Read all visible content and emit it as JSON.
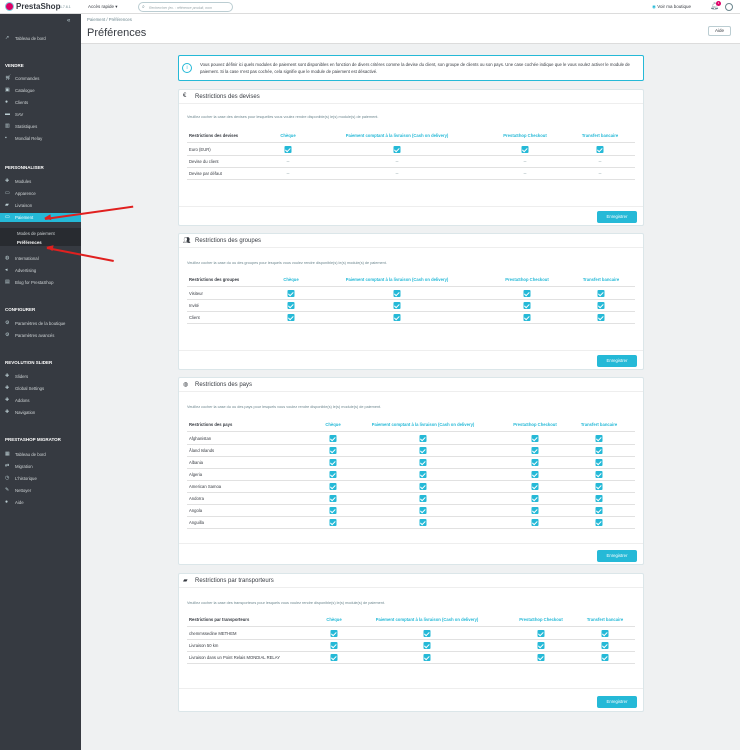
{
  "topbar": {
    "brand": "PrestaShop",
    "version": "1.7.6.1",
    "quick_access": "Accès rapide ▾",
    "search_placeholder": "Rechercher (ex. : référence produit, nom",
    "view_shop": "Voir ma boutique",
    "notif_count": "1"
  },
  "sidebar": {
    "dashboard": "Tableau de bord",
    "sections": [
      {
        "title": "VENDRE",
        "items": [
          "Commandes",
          "Catalogue",
          "Clients",
          "SAV",
          "Statistiques",
          "Mondial Relay"
        ]
      },
      {
        "title": "PERSONNALISER",
        "items": [
          "Modules",
          "Apparence",
          "Livraison",
          "Paiement",
          "International",
          "Advertising",
          "Blog for PrestaShop"
        ],
        "subitems": [
          "Modes de paiement",
          "Préférences"
        ]
      },
      {
        "title": "CONFIGURER",
        "items": [
          "Paramètres de la boutique",
          "Paramètres avancés"
        ]
      },
      {
        "title": "REVOLUTION SLIDER",
        "items": [
          "Sliders",
          "Global Settings",
          "Addons",
          "Navigation"
        ]
      },
      {
        "title": "PRESTASHOP MIGRATOR",
        "items": [
          "Tableau de bord",
          "Migration",
          "L'historique",
          "Nettoyer",
          "Aide"
        ]
      }
    ]
  },
  "header": {
    "breadcrumb": "Paiement  /  Préférences",
    "title": "Préférences",
    "help": "Aide"
  },
  "info": "Vous pouvez définir ici quels modules de paiement sont disponibles en fonction de divers critères comme la devise du client, son groupe de clients ou son pays. Une case cochée indique que le vous voulez activer le module de paiement. Si la case n'est pas cochée, cela signifie que le module de paiement est désactivé.",
  "columns": [
    "Chèque",
    "Paiement comptant à la livraison (Cash on delivery)",
    "PrestaShop Checkout",
    "Transfert bancaire"
  ],
  "save_label": "Enregistrer",
  "panels": {
    "currency": {
      "title": "Restrictions des devises",
      "desc": "Veuillez cocher la case des devises pour lesquelles vous voulez rendre disponible(s) le(s) module(s) de paiement.",
      "col0": "Restrictions des devises",
      "rows": [
        {
          "label": "Euro (EUR)",
          "cells": [
            "check",
            "check",
            "check",
            "check"
          ]
        },
        {
          "label": "Devise du client",
          "cells": [
            "--",
            "--",
            "--",
            "--"
          ]
        },
        {
          "label": "Devise par défaut",
          "cells": [
            "--",
            "--",
            "--",
            "--"
          ]
        }
      ]
    },
    "groups": {
      "title": "Restrictions des groupes",
      "desc": "Veuillez cocher la case du ou des groupes pour lesquels vous voulez rendre disponible(s) le(s) module(s) de paiement.",
      "col0": "Restrictions des groupes",
      "rows": [
        {
          "label": "Visiteur"
        },
        {
          "label": "Invité"
        },
        {
          "label": "Client"
        }
      ]
    },
    "countries": {
      "title": "Restrictions des pays",
      "desc": "Veuillez cocher la case du ou des pays pour lesquels vous voulez rendre disponible(s) le(s) module(s) de paiement.",
      "col0": "Restrictions des pays",
      "rows": [
        {
          "label": "Afghanistan"
        },
        {
          "label": "Åland Islands"
        },
        {
          "label": "Albania"
        },
        {
          "label": "Algeria"
        },
        {
          "label": "American Samoa"
        },
        {
          "label": "Andorra"
        },
        {
          "label": "Angola"
        },
        {
          "label": "Anguilla"
        }
      ]
    },
    "carriers": {
      "title": "Restrictions par transporteurs",
      "desc": "Veuillez cocher la case des transporteurs pour lesquels vous voulez rendre disponible(s) le(s) module(s) de paiement.",
      "col0": "Restrictions par transporteurs",
      "rows": [
        {
          "label": "chemmssedine METHEM"
        },
        {
          "label": "Livraison 50 km"
        },
        {
          "label": "Livraison dans un Point Relais MONDIAL RELAY"
        }
      ]
    }
  },
  "colors": {
    "accent": "#25b9d7",
    "sidebar": "#363a41",
    "annotation": "#e0201f"
  },
  "icons": {
    "currency": "euro-icon",
    "groups": "users-icon",
    "countries": "globe-icon",
    "carriers": "truck-icon"
  }
}
